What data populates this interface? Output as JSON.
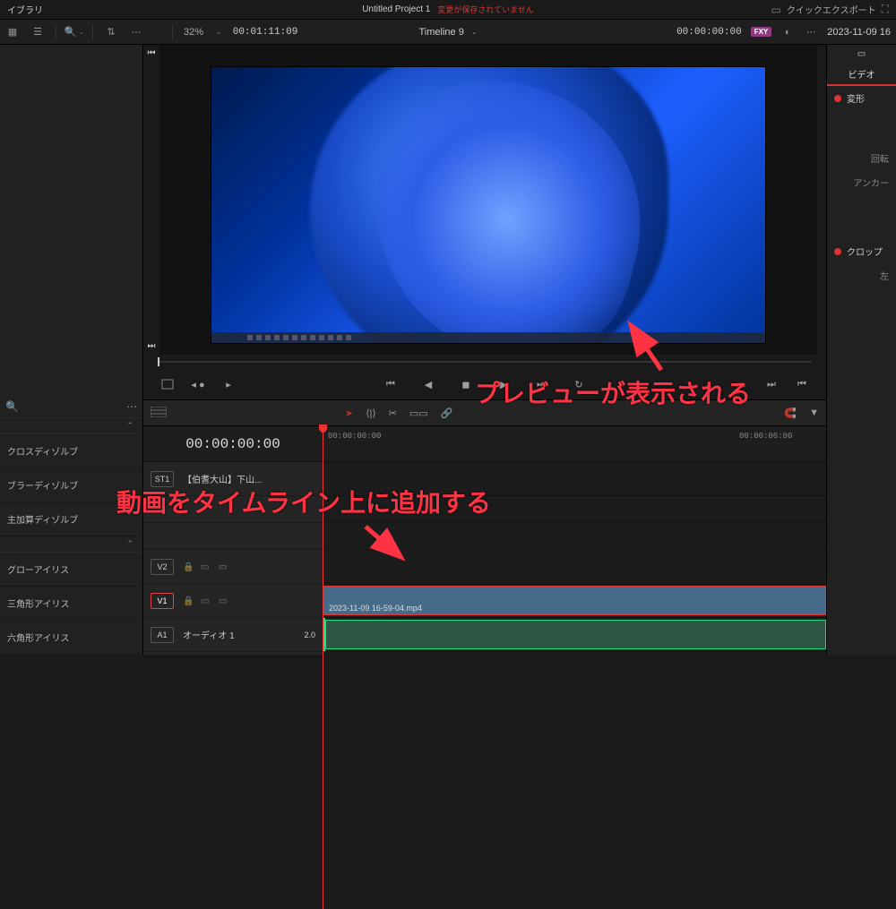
{
  "topbar": {
    "library_label": "イブラリ",
    "project_title": "Untitled Project 1",
    "save_warning": "変更が保存されていません",
    "quick_export": "クイックエクスポート",
    "right_date": "2023-11-09 16"
  },
  "toolbar": {
    "zoom_pct": "32%",
    "source_tc": "00:01:11:09",
    "timeline_name": "Timeline 9",
    "record_tc": "00:00:00:00",
    "fx_badge": "FXY"
  },
  "transitions": {
    "items": [
      "クロスディゾルブ",
      "ブラーディゾルブ",
      "主加算ディゾルブ",
      "",
      "グローアイリス",
      "三角形アイリス",
      "六角形アイリス"
    ]
  },
  "timeline": {
    "head_tc": "00:00:00:00",
    "ruler_ticks": [
      "00:00:00:00",
      "00:00:06:00"
    ],
    "subtitle_track": {
      "name": "ST1",
      "clip_label": "【伯耆大山】下山..."
    },
    "video_tracks": [
      {
        "name": "V2"
      },
      {
        "name": "V1",
        "active": true
      }
    ],
    "audio_tracks": [
      {
        "name": "A1",
        "label": "オーディオ 1",
        "vol": "2.0"
      }
    ],
    "clip_filename": "2023-11-09 16-59-04.mp4"
  },
  "inspector": {
    "tab_video": "ビデオ",
    "transform": "変形",
    "rotation": "回転",
    "anchor": "アンカー",
    "crop": "クロップ",
    "left_label": "左"
  },
  "annotations": {
    "preview_shown": "プレビューが表示される",
    "add_to_timeline": "動画をタイムライン上に追加する"
  }
}
